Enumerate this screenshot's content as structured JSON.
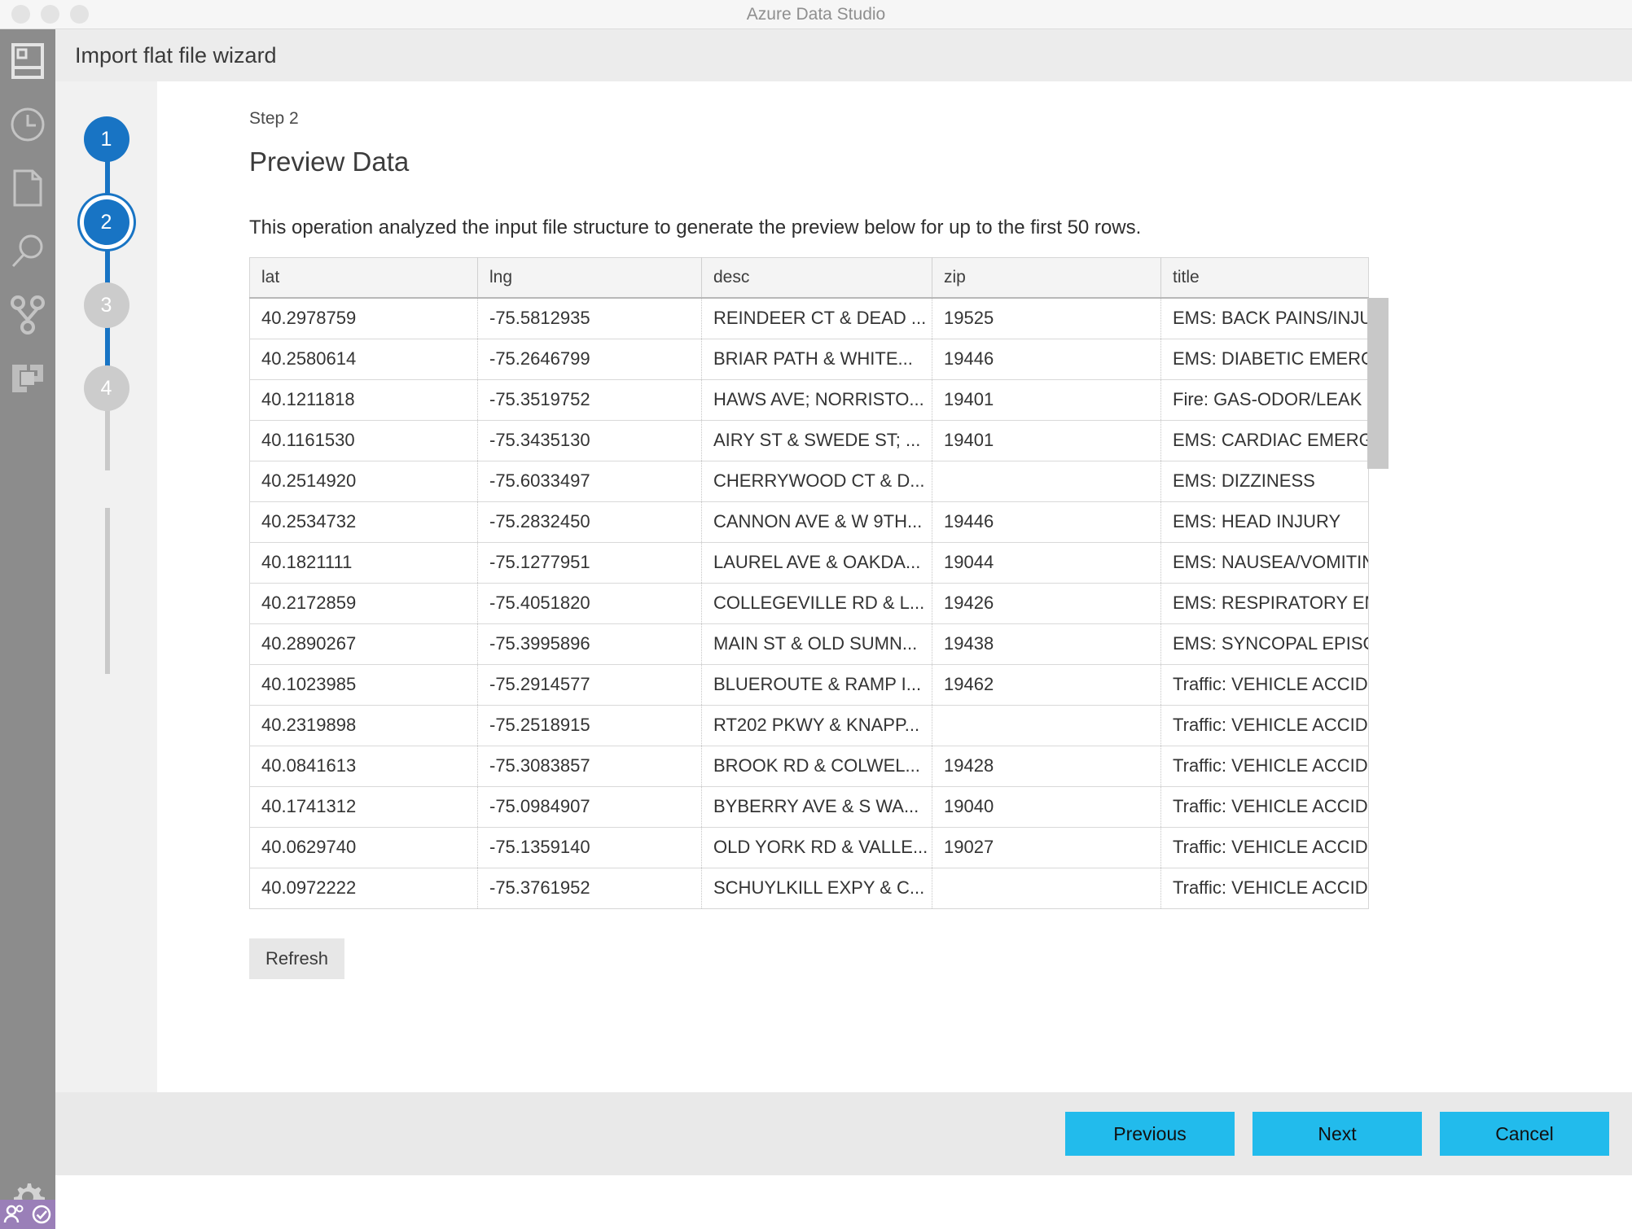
{
  "window": {
    "app_title": "Azure Data Studio",
    "traffic_lights": [
      "close",
      "minimize",
      "maximize"
    ]
  },
  "activity_bar": {
    "items": [
      {
        "icon": "servers-icon",
        "label": "Servers"
      },
      {
        "icon": "history-clock-icon",
        "label": "History"
      },
      {
        "icon": "file-document-icon",
        "label": "Notebooks"
      },
      {
        "icon": "search-magnifier-icon",
        "label": "Search"
      },
      {
        "icon": "source-control-branch-icon",
        "label": "Source Control"
      },
      {
        "icon": "extensions-icon",
        "label": "Extensions"
      }
    ],
    "bottom_items": [
      {
        "icon": "gear-icon",
        "label": "Manage"
      }
    ],
    "status": [
      {
        "icon": "accounts-person-icon",
        "label": "Accounts"
      },
      {
        "icon": "check-circle-icon",
        "label": "Status"
      }
    ]
  },
  "wizard": {
    "title": "Import flat file wizard",
    "steps": [
      {
        "number": "1",
        "state": "done"
      },
      {
        "number": "2",
        "state": "active"
      },
      {
        "number": "3",
        "state": "pending"
      },
      {
        "number": "4",
        "state": "pending"
      }
    ],
    "step_label": "Step 2",
    "heading": "Preview Data",
    "description": "This operation analyzed the input file structure to generate the preview below for up to the first 50 rows.",
    "refresh_label": "Refresh",
    "footer_buttons": {
      "previous": "Previous",
      "next": "Next",
      "cancel": "Cancel"
    }
  },
  "colors": {
    "accent_blue": "#1874c4",
    "button_cyan": "#22bbec",
    "activity_bar": "#8c8c8c",
    "status_bar": "#9a7fb8",
    "step_pending": "#cccccc"
  },
  "preview_table": {
    "columns": [
      "lat",
      "lng",
      "desc",
      "zip",
      "title"
    ],
    "rows": [
      [
        "40.2978759",
        "-75.5812935",
        "REINDEER CT & DEAD ...",
        "19525",
        "EMS: BACK PAINS/INJU..."
      ],
      [
        "40.2580614",
        "-75.2646799",
        "BRIAR PATH & WHITE...",
        "19446",
        "EMS: DIABETIC EMERG..."
      ],
      [
        "40.1211818",
        "-75.3519752",
        "HAWS AVE; NORRISTO...",
        "19401",
        "Fire: GAS-ODOR/LEAK"
      ],
      [
        "40.1161530",
        "-75.3435130",
        "AIRY ST & SWEDE ST; ...",
        "19401",
        "EMS: CARDIAC EMERG..."
      ],
      [
        "40.2514920",
        "-75.6033497",
        "CHERRYWOOD CT & D...",
        "",
        "EMS: DIZZINESS"
      ],
      [
        "40.2534732",
        "-75.2832450",
        "CANNON AVE & W 9TH...",
        "19446",
        "EMS: HEAD INJURY"
      ],
      [
        "40.1821111",
        "-75.1277951",
        "LAUREL AVE & OAKDA...",
        "19044",
        "EMS: NAUSEA/VOMITING"
      ],
      [
        "40.2172859",
        "-75.4051820",
        "COLLEGEVILLE RD & L...",
        "19426",
        "EMS: RESPIRATORY EM..."
      ],
      [
        "40.2890267",
        "-75.3995896",
        "MAIN ST & OLD SUMN...",
        "19438",
        "EMS: SYNCOPAL EPISO..."
      ],
      [
        "40.1023985",
        "-75.2914577",
        "BLUEROUTE & RAMP I...",
        "19462",
        "Traffic: VEHICLE ACCID..."
      ],
      [
        "40.2319898",
        "-75.2518915",
        "RT202 PKWY & KNAPP...",
        "",
        "Traffic: VEHICLE ACCID..."
      ],
      [
        "40.0841613",
        "-75.3083857",
        "BROOK RD & COLWEL...",
        "19428",
        "Traffic: VEHICLE ACCID..."
      ],
      [
        "40.1741312",
        "-75.0984907",
        "BYBERRY AVE & S WA...",
        "19040",
        "Traffic: VEHICLE ACCID..."
      ],
      [
        "40.0629740",
        "-75.1359140",
        "OLD YORK RD & VALLE...",
        "19027",
        "Traffic: VEHICLE ACCID..."
      ],
      [
        "40.0972222",
        "-75.3761952",
        "SCHUYLKILL EXPY & C...",
        "",
        "Traffic: VEHICLE ACCID..."
      ]
    ]
  }
}
